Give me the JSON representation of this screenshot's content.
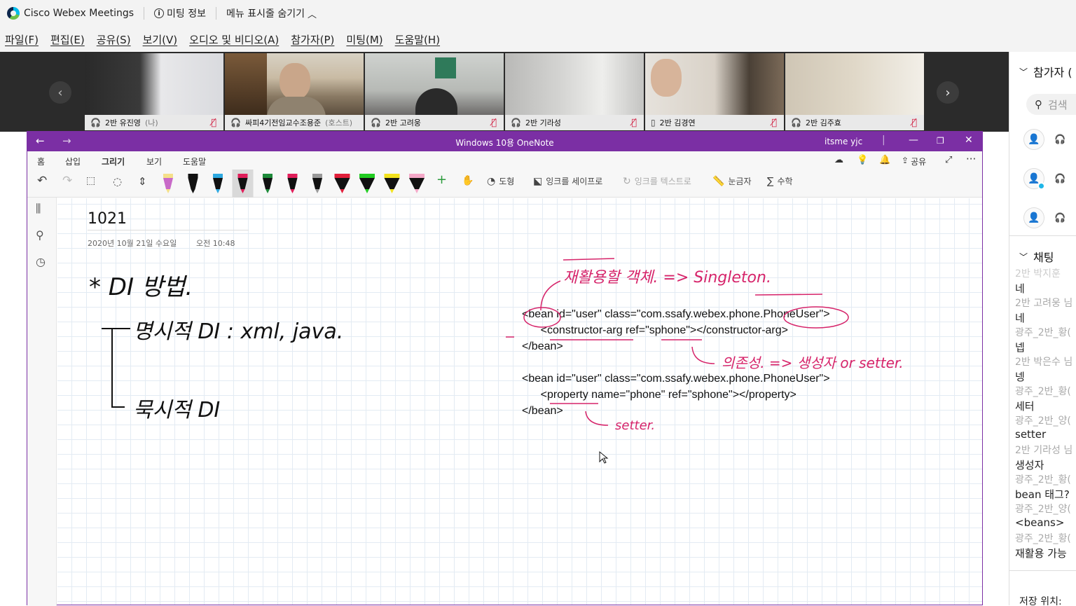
{
  "app": {
    "name": "Cisco Webex Meetings",
    "meeting_info": "미팅 정보",
    "hide_menu": "메뉴 표시줄 숨기기"
  },
  "menu": [
    "파일(F)",
    "편집(E)",
    "공유(S)",
    "보기(V)",
    "오디오 및 비디오(A)",
    "참가자(P)",
    "미팅(M)",
    "도움말(H)"
  ],
  "participants_strip": [
    {
      "name": "2반 유진영",
      "suffix": "(나)",
      "active": false
    },
    {
      "name": "싸피4기전임교수조용준",
      "suffix": "(호스트)",
      "active": true
    },
    {
      "name": "2반 고려웅",
      "suffix": "",
      "active": false
    },
    {
      "name": "2반 기라성",
      "suffix": "",
      "active": false
    },
    {
      "name": "2반 김경연",
      "suffix": "",
      "active": false
    },
    {
      "name": "2반 김주효",
      "suffix": "",
      "active": false
    }
  ],
  "right_panel": {
    "participants_title": "참가자 (",
    "search_placeholder": "검색",
    "chat_title": "채팅",
    "chat": [
      {
        "sender": "2반 박지훈",
        "msg": "네"
      },
      {
        "sender": "2반 고려웅 님",
        "msg": "네"
      },
      {
        "sender": "광주_2반_황(",
        "msg": "넵"
      },
      {
        "sender": "2반 박은수 님",
        "msg": "넹"
      },
      {
        "sender": "광주_2반_황(",
        "msg": "세터"
      },
      {
        "sender": "광주_2반_양(",
        "msg": "setter"
      },
      {
        "sender": "2반 기라성 님",
        "msg": "생성자"
      },
      {
        "sender": "광주_2반_황(",
        "msg": "bean 태그?"
      },
      {
        "sender": "광주_2반_양(",
        "msg": "<beans>"
      },
      {
        "sender": "광주_2반_황(",
        "msg": "재활용 가능"
      }
    ],
    "save_location": "저장 위치:"
  },
  "onenote": {
    "window_title": "Windows 10용 OneNote",
    "user": "itsme yjc",
    "tabs": [
      "홈",
      "삽입",
      "그리기",
      "보기",
      "도움말"
    ],
    "ribbon": {
      "shapes": "도형",
      "ink_to_shape": "잉크를 세이프로",
      "ink_to_text": "잉크를 텍스트로",
      "ruler": "눈금자",
      "math": "수학",
      "share": "공유"
    },
    "page": {
      "title": "1021",
      "date": "2020년 10월 21일 수요일",
      "time": "오전 10:48"
    },
    "code_blocks": [
      [
        "<bean id=\"user\" class=\"com.ssafy.webex.phone.PhoneUser\">",
        "      <constructor-arg ref=\"sphone\"></constructor-arg>",
        "</bean>"
      ],
      [
        "<bean id=\"user\" class=\"com.ssafy.webex.phone.PhoneUser\">",
        "      <property name=\"phone\" ref=\"sphone\"></property>",
        "</bean>"
      ]
    ],
    "handwriting": {
      "heading": "* DI 방법.",
      "explicit": "명시적 DI   :  xml, java.",
      "implicit": "묵시적 DI",
      "reuse_note": "재활용할 객체. => Singleton.",
      "dependency_note": "의존성. => 생성자 or setter.",
      "setter_note": "setter."
    }
  }
}
